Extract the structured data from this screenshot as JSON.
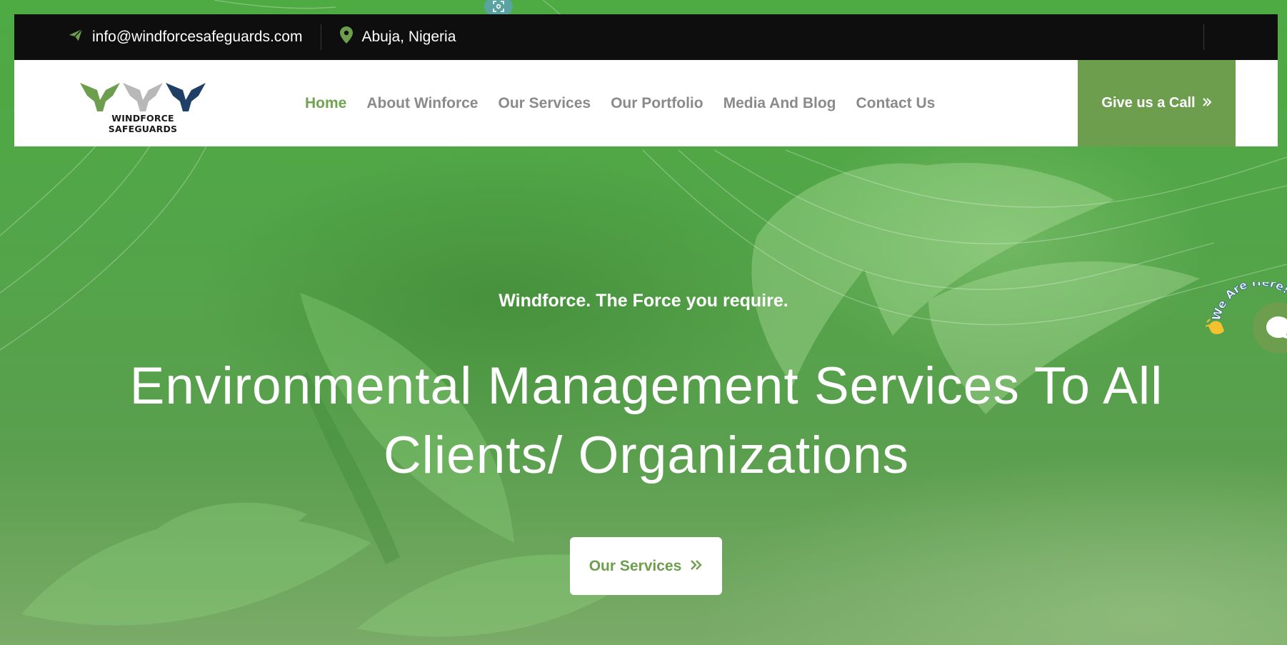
{
  "topbar": {
    "email": "info@windforcesafeguards.com",
    "location": "Abuja, Nigeria",
    "icons": {
      "email": "send-icon",
      "location": "map-pin-icon"
    }
  },
  "header": {
    "logo_text": "WINDFORCE SAFEGUARDS",
    "nav": [
      {
        "label": "Home",
        "active": true
      },
      {
        "label": "About Winforce",
        "active": false
      },
      {
        "label": "Our Services",
        "active": false
      },
      {
        "label": "Our Portfolio",
        "active": false
      },
      {
        "label": "Media And Blog",
        "active": false
      },
      {
        "label": "Contact Us",
        "active": false
      }
    ],
    "call_button": "Give us a Call",
    "call_icon": "double-chevron-right-icon"
  },
  "hero": {
    "tagline": "Windforce. The Force you require.",
    "headline_line1": "Environmental Management Services To All",
    "headline_line2": "Clients/ Organizations",
    "cta": "Our Services",
    "cta_icon": "double-chevron-right-icon"
  },
  "chat_widget": {
    "label": "We Are Here!",
    "icons": [
      "waving-hand-icon",
      "chat-bubble-icon"
    ]
  },
  "colors": {
    "brand_green": "#6d9e4e",
    "hero_green": "#4faa44",
    "topbar_black": "#0e0e0f",
    "nav_gray": "#8a8a8a",
    "white": "#ffffff"
  }
}
